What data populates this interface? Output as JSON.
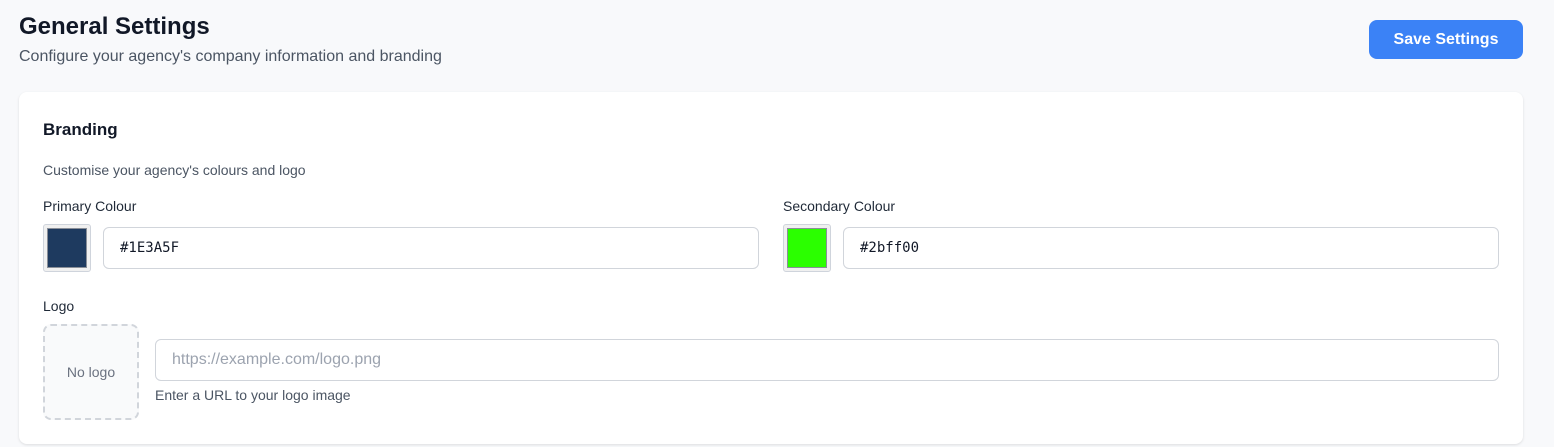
{
  "header": {
    "title": "General Settings",
    "subtitle": "Configure your agency's company information and branding",
    "save_label": "Save Settings"
  },
  "branding": {
    "title": "Branding",
    "description": "Customise your agency's colours and logo",
    "primary": {
      "label": "Primary Colour",
      "value": "#1E3A5F",
      "color": "#1e3a5f"
    },
    "secondary": {
      "label": "Secondary Colour",
      "value": "#2bff00",
      "color": "#2bff00"
    },
    "logo": {
      "label": "Logo",
      "placeholder_text": "No logo",
      "url_value": "",
      "url_placeholder": "https://example.com/logo.png",
      "helper": "Enter a URL to your logo image"
    }
  },
  "colors": {
    "accent": "#3b82f6"
  }
}
